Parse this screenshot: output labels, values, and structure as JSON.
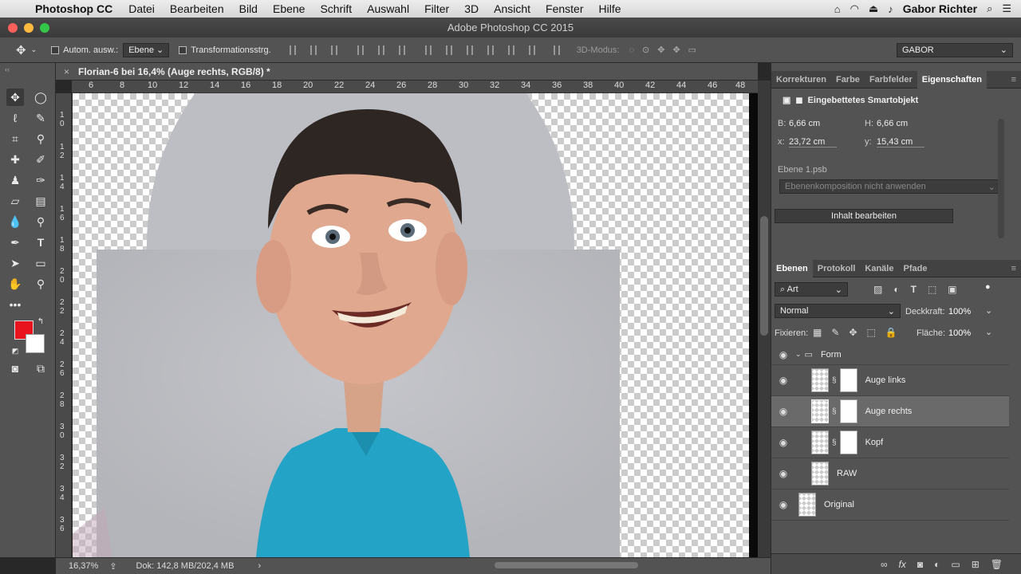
{
  "menubar": {
    "app": "Photoshop CC",
    "items": [
      "Datei",
      "Bearbeiten",
      "Bild",
      "Ebene",
      "Schrift",
      "Auswahl",
      "Filter",
      "3D",
      "Ansicht",
      "Fenster",
      "Hilfe"
    ],
    "user": "Gabor Richter"
  },
  "window": {
    "title": "Adobe Photoshop CC 2015"
  },
  "options": {
    "auto_select_label": "Autom. ausw.:",
    "auto_select_value": "Ebene",
    "transform_label": "Transformationsstrg.",
    "mode3d_label": "3D-Modus:",
    "workspace": "GABOR"
  },
  "tools": {
    "header": "‹‹"
  },
  "document": {
    "tab_title": "Florian-6 bei 16,4% (Auge rechts, RGB/8) *",
    "ruler_h": [
      "6",
      "8",
      "10",
      "12",
      "14",
      "16",
      "18",
      "20",
      "22",
      "24",
      "26",
      "28",
      "30",
      "32",
      "34",
      "36",
      "38",
      "40",
      "42",
      "44",
      "46",
      "48"
    ],
    "ruler_v": [
      "1 0",
      "1 2",
      "1 4",
      "1 6",
      "1 8",
      "2 0",
      "2 2",
      "2 4",
      "2 6",
      "2 8",
      "3 0",
      "3 2",
      "3 4",
      "3 6"
    ]
  },
  "status": {
    "zoom": "16,37%",
    "doc": "Dok: 142,8 MB/202,4 MB"
  },
  "properties": {
    "tabs": [
      "Korrekturen",
      "Farbe",
      "Farbfelder",
      "Eigenschaften"
    ],
    "active_tab": "Eigenschaften",
    "object_type": "Eingebettetes Smartobjekt",
    "w_label": "B:",
    "w_value": "6,66 cm",
    "h_label": "H:",
    "h_value": "6,66 cm",
    "x_label": "x:",
    "x_value": "23,72 cm",
    "y_label": "y:",
    "y_value": "15,43 cm",
    "layer_file": "Ebene 1.psb",
    "comp_placeholder": "Ebenenkomposition nicht anwenden",
    "edit_button": "Inhalt bearbeiten"
  },
  "layers_panel": {
    "tabs": [
      "Ebenen",
      "Protokoll",
      "Kanäle",
      "Pfade"
    ],
    "active_tab": "Ebenen",
    "filter_value": "Art",
    "blend_mode": "Normal",
    "opacity_label": "Deckkraft:",
    "opacity_value": "100%",
    "lock_label": "Fixieren:",
    "fill_label": "Fläche:",
    "fill_value": "100%",
    "group": "Form",
    "layers": [
      {
        "name": "Auge links",
        "selected": false
      },
      {
        "name": "Auge rechts",
        "selected": true
      },
      {
        "name": "Kopf",
        "selected": false
      },
      {
        "name": "RAW",
        "selected": false
      },
      {
        "name": "Original",
        "selected": false
      }
    ]
  }
}
